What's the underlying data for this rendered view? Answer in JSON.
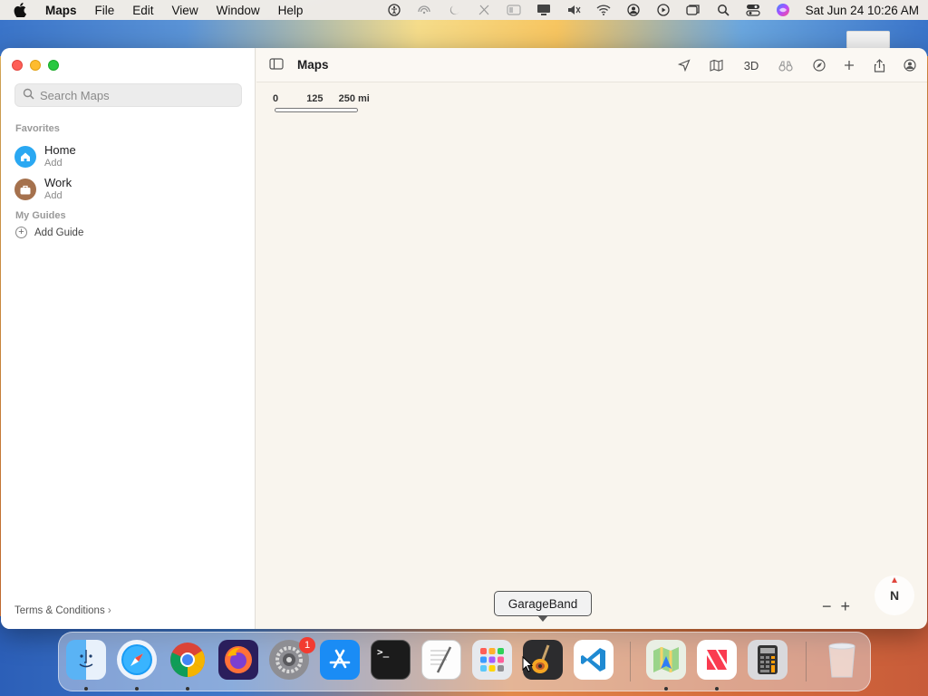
{
  "menubar": {
    "app_name": "Maps",
    "menus": [
      "File",
      "Edit",
      "View",
      "Window",
      "Help"
    ],
    "clock": "Sat Jun 24  10:26 AM"
  },
  "window": {
    "title": "Maps",
    "toolbar": {
      "btn_3d": "3D"
    }
  },
  "sidebar": {
    "search_placeholder": "Search Maps",
    "favorites_title": "Favorites",
    "favorites": [
      {
        "name": "Home",
        "sub": "Add",
        "color": "#2aa8f2",
        "icon": "house-icon"
      },
      {
        "name": "Work",
        "sub": "Add",
        "color": "#a5714d",
        "icon": "briefcase-icon"
      }
    ],
    "guides_title": "My Guides",
    "add_guide": "Add Guide",
    "terms": "Terms & Conditions"
  },
  "map": {
    "scale": {
      "zero": "0",
      "mid": "125",
      "max": "250 mi"
    },
    "compass": "N"
  },
  "tooltip": "GarageBand",
  "dock": {
    "apps": [
      "Finder",
      "Safari",
      "Chrome",
      "Firefox",
      "System Preferences",
      "App Store",
      "Terminal",
      "TextEdit",
      "Launchpad",
      "GarageBand",
      "Visual Studio Code",
      "Maps",
      "News",
      "Calculator",
      "Trash"
    ],
    "system_prefs_badge": "1"
  }
}
